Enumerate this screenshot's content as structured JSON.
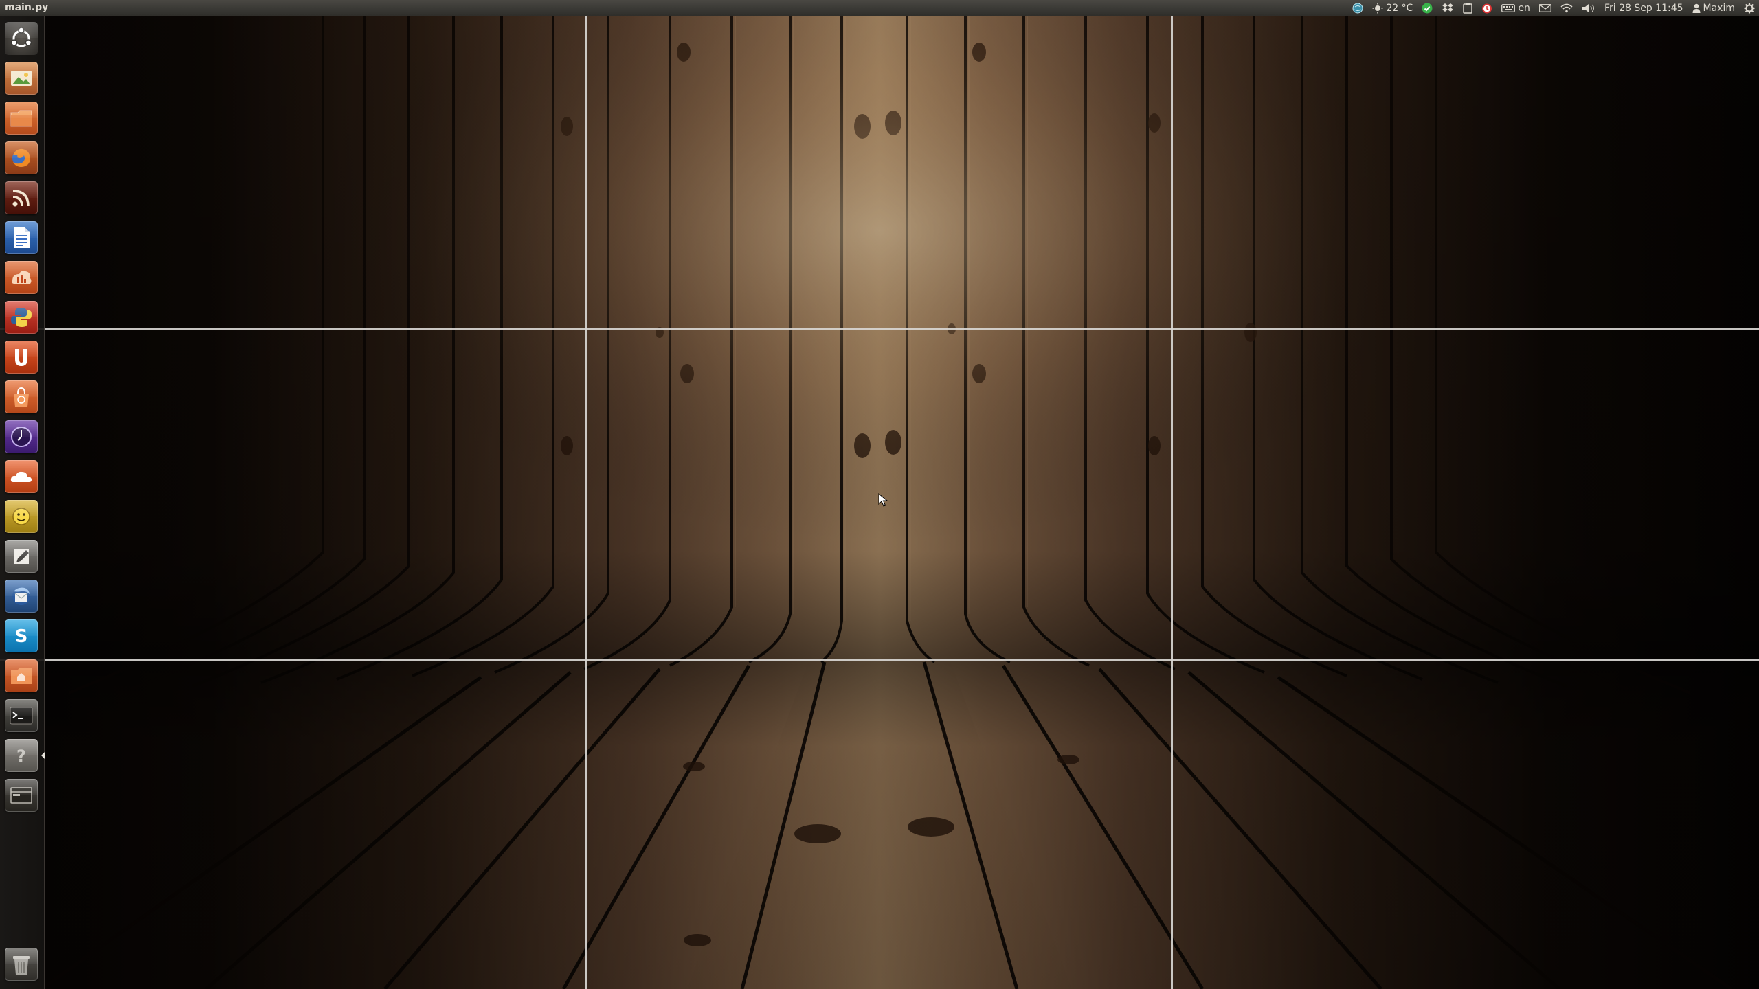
{
  "top_panel": {
    "window_title": "main.py",
    "weather": "22 °C",
    "keyboard_layout": "en",
    "datetime": "Fri 28 Sep 11:45",
    "user_name": "Maxim"
  },
  "launcher": {
    "items": [
      {
        "name": "dash-home",
        "icon": "ubuntu-logo-icon"
      },
      {
        "name": "image-viewer",
        "icon": "photo-icon"
      },
      {
        "name": "files",
        "icon": "folder-icon"
      },
      {
        "name": "firefox",
        "icon": "firefox-icon"
      },
      {
        "name": "rss-reader",
        "icon": "rss-icon"
      },
      {
        "name": "writer",
        "icon": "document-icon"
      },
      {
        "name": "system-monitor",
        "icon": "chart-icon"
      },
      {
        "name": "python",
        "icon": "python-icon"
      },
      {
        "name": "ubuntu-one-music",
        "icon": "u-icon"
      },
      {
        "name": "software-center",
        "icon": "shopping-bag-icon"
      },
      {
        "name": "clock",
        "icon": "clock-icon"
      },
      {
        "name": "ubuntu-one",
        "icon": "cloud-icon"
      },
      {
        "name": "face-app",
        "icon": "smiley-icon"
      },
      {
        "name": "text-editor",
        "icon": "pencil-icon"
      },
      {
        "name": "thunderbird",
        "icon": "mail-bird-icon"
      },
      {
        "name": "skype",
        "icon": "skype-icon"
      },
      {
        "name": "home-folder",
        "icon": "home-folder-icon"
      },
      {
        "name": "terminal",
        "icon": "terminal-icon"
      },
      {
        "name": "help",
        "icon": "question-icon"
      },
      {
        "name": "workspace-switcher",
        "icon": "workspaces-icon"
      },
      {
        "name": "trash",
        "icon": "trash-icon"
      }
    ]
  },
  "colors": {
    "panel": "#3c3b37",
    "panel_text": "#dfdbd2",
    "grid_lines": "#d8d6d2",
    "wood_light": "#b08a63",
    "wood_dark": "#1a0f08"
  }
}
